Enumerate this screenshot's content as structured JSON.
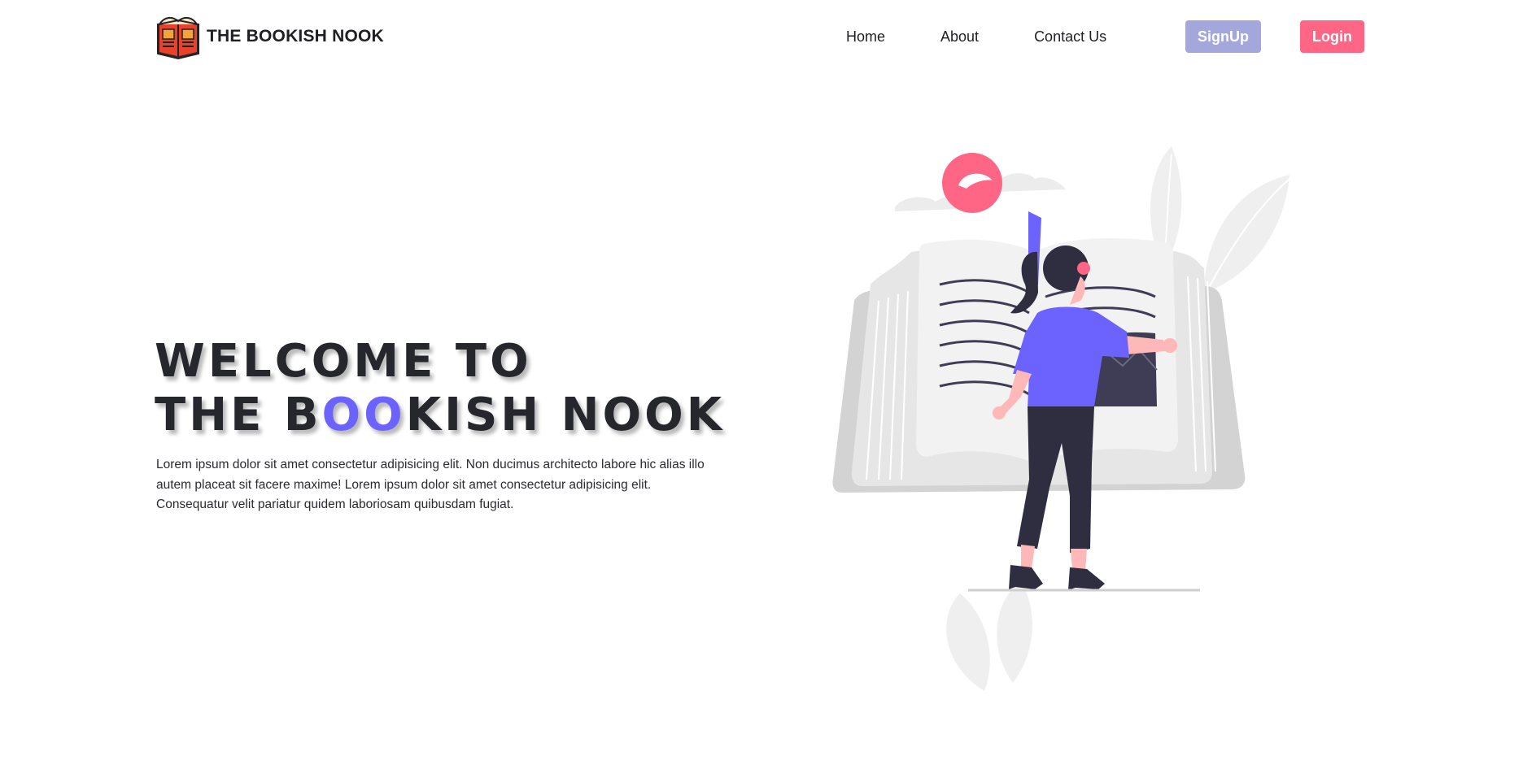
{
  "brand": {
    "name": "THE BOOKISH NOOK",
    "logo_icon": "open-book-logo-icon"
  },
  "nav": {
    "links": [
      {
        "label": "Home"
      },
      {
        "label": "About"
      },
      {
        "label": "Contact Us"
      }
    ],
    "signup_label": "SignUp",
    "login_label": "Login"
  },
  "hero": {
    "title_line1": "WELCOME TO",
    "title_line2_before": "THE B",
    "title_line2_accent": "OO",
    "title_line2_after": "KISH NOOK",
    "description": "Lorem ipsum dolor sit amet consectetur adipisicing elit. Non ducimus architecto labore hic alias illo autem placeat sit facere maxime! Lorem ipsum dolor sit amet consectetur adipisicing elit. Consequatur velit pariatur quidem laboriosam quibusdam fugiat.",
    "illustration_icon": "woman-reading-book-illustration"
  },
  "colors": {
    "accent": "#6c63ff",
    "pink": "#ff6584",
    "signup_bg": "#a3a7dc",
    "text_dark": "#26272d"
  }
}
